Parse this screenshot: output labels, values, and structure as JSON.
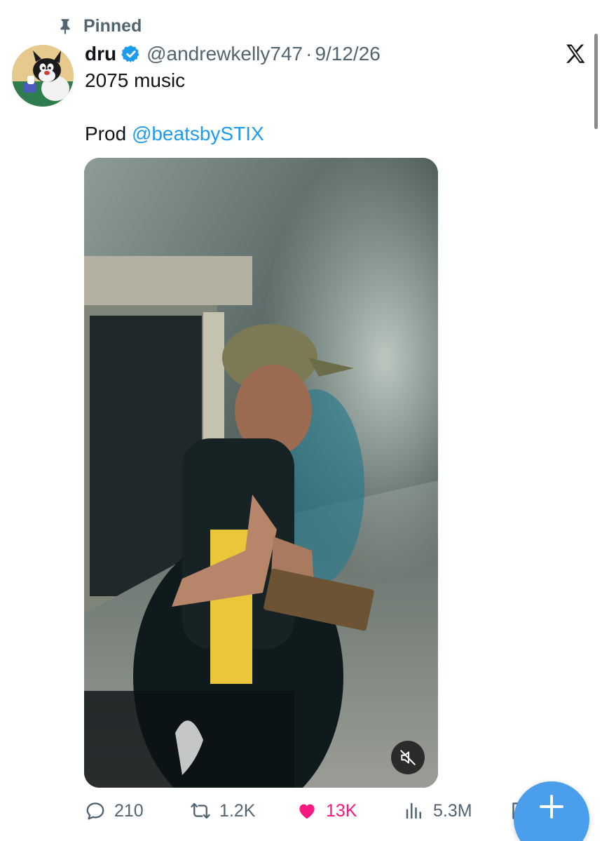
{
  "pinned": {
    "label": "Pinned",
    "icon": "pin-icon"
  },
  "author": {
    "display_name": "dru",
    "verified_icon": "verified-badge-icon",
    "handle": "@andrewkelly747",
    "separator": "·",
    "date": "9/12/26",
    "avatar": "sylvester-cat-avatar"
  },
  "platform_logo": "x-logo-icon",
  "tweet": {
    "line1": "2075 music",
    "line2_prefix": "Prod ",
    "line2_mention": "@beatsbySTIX"
  },
  "media": {
    "type": "video",
    "description_icon": "video-thumbnail",
    "mute_icon": "muted-speaker-icon"
  },
  "actions": {
    "replies": {
      "icon": "reply-icon",
      "count": "210"
    },
    "reposts": {
      "icon": "repost-icon",
      "count": "1.2K"
    },
    "likes": {
      "icon": "heart-filled-icon",
      "count": "13K"
    },
    "views": {
      "icon": "views-chart-icon",
      "count": "5.3M"
    },
    "bookmark": {
      "icon": "bookmark-icon"
    }
  },
  "fab": {
    "icon": "plus-icon"
  },
  "colors": {
    "accent": "#1d9bf0",
    "like": "#f91880",
    "muted_text": "#536471",
    "fab": "#4a9eeb"
  }
}
